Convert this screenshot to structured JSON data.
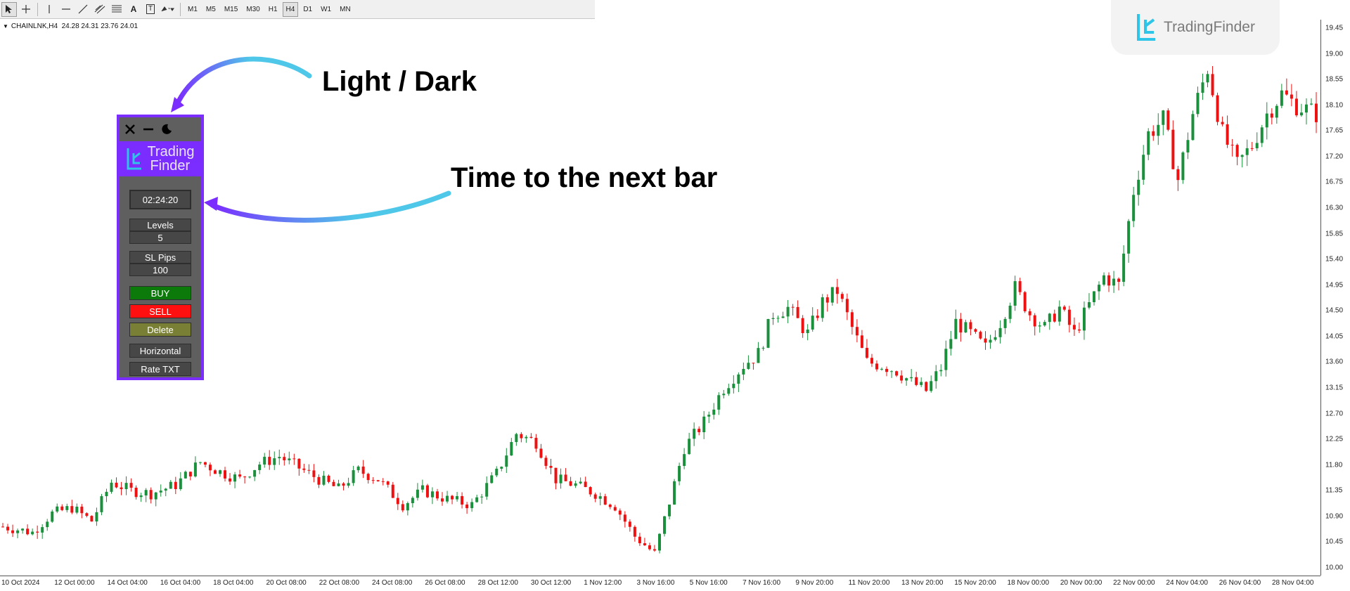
{
  "toolbar": {
    "tool_icons": [
      "cursor-icon",
      "crosshair-icon",
      "vertical-line-icon",
      "horizontal-line-icon",
      "trendline-icon",
      "channel-icon",
      "fibonacci-icon",
      "text-icon",
      "label-icon",
      "shapes-icon"
    ],
    "text_tool_label": "A",
    "label_tool_label": "T",
    "timeframes": [
      "M1",
      "M5",
      "M15",
      "M30",
      "H1",
      "H4",
      "D1",
      "W1",
      "MN"
    ],
    "active_timeframe": "H4"
  },
  "symbol_info": {
    "symbol": "CHAINLNK,H4",
    "ohlc": "24.28 24.31 23.76 24.01"
  },
  "brand": {
    "name": "TradingFinder",
    "color": "#2ec5e8"
  },
  "callouts": {
    "theme_toggle": "Light / Dark",
    "bar_timer": "Time to the next bar"
  },
  "panel": {
    "header_icons": [
      "close-icon",
      "minimize-icon",
      "moon-icon"
    ],
    "logo_line1": "Trading",
    "logo_line2": "Finder",
    "timer": "02:24:20",
    "levels_label": "Levels",
    "levels_value": "5",
    "sl_label": "SL Pips",
    "sl_value": "100",
    "buy_label": "BUY",
    "sell_label": "SELL",
    "delete_label": "Delete",
    "horizontal_label": "Horizontal",
    "rate_label": "Rate TXT",
    "accent_color": "#7b2cff"
  },
  "colors": {
    "bull": "#1a8f3c",
    "bear": "#ee1111"
  },
  "chart_data": {
    "type": "candlestick",
    "price_axis_labels": [
      "19.45",
      "19.00",
      "18.55",
      "18.10",
      "17.65",
      "17.20",
      "16.75",
      "16.30",
      "15.85",
      "15.40",
      "14.95",
      "14.50",
      "14.05",
      "13.60",
      "13.15",
      "12.70",
      "12.25",
      "11.80",
      "11.35",
      "10.90",
      "10.45",
      "10.00"
    ],
    "time_axis_labels": [
      "10 Oct 2024",
      "12 Oct 00:00",
      "14 Oct 04:00",
      "16 Oct 04:00",
      "18 Oct 04:00",
      "20 Oct 08:00",
      "22 Oct 08:00",
      "24 Oct 08:00",
      "26 Oct 08:00",
      "28 Oct 12:00",
      "30 Oct 12:00",
      "1 Nov 12:00",
      "3 Nov 16:00",
      "5 Nov 16:00",
      "7 Nov 16:00",
      "9 Nov 20:00",
      "11 Nov 20:00",
      "13 Nov 20:00",
      "15 Nov 20:00",
      "18 Nov 00:00",
      "20 Nov 00:00",
      "22 Nov 00:00",
      "24 Nov 04:00",
      "26 Nov 04:00",
      "28 Nov 04:00"
    ],
    "y_range": [
      9.9,
      19.5
    ],
    "close_path": [
      [
        0,
        10.72
      ],
      [
        6,
        10.62
      ],
      [
        10,
        10.95
      ],
      [
        14,
        11.05
      ],
      [
        18,
        10.82
      ],
      [
        22,
        11.5
      ],
      [
        26,
        11.35
      ],
      [
        30,
        11.3
      ],
      [
        35,
        11.45
      ],
      [
        40,
        11.85
      ],
      [
        44,
        11.68
      ],
      [
        48,
        11.55
      ],
      [
        52,
        11.82
      ],
      [
        56,
        11.95
      ],
      [
        60,
        11.75
      ],
      [
        64,
        11.55
      ],
      [
        68,
        11.38
      ],
      [
        72,
        11.7
      ],
      [
        76,
        11.55
      ],
      [
        81,
        11.1
      ],
      [
        85,
        11.35
      ],
      [
        90,
        11.2
      ],
      [
        95,
        11.1
      ],
      [
        100,
        11.65
      ],
      [
        104,
        12.35
      ],
      [
        108,
        12.2
      ],
      [
        112,
        11.55
      ],
      [
        116,
        11.45
      ],
      [
        120,
        11.3
      ],
      [
        124,
        11.08
      ],
      [
        128,
        10.55
      ],
      [
        132,
        10.25
      ],
      [
        135,
        11.15
      ],
      [
        138,
        12.1
      ],
      [
        142,
        12.55
      ],
      [
        146,
        13.15
      ],
      [
        150,
        13.55
      ],
      [
        153,
        13.75
      ],
      [
        156,
        14.45
      ],
      [
        159,
        14.55
      ],
      [
        163,
        14.1
      ],
      [
        166,
        14.65
      ],
      [
        169,
        14.85
      ],
      [
        172,
        14.2
      ],
      [
        175,
        13.6
      ],
      [
        178,
        13.55
      ],
      [
        181,
        13.45
      ],
      [
        184,
        13.25
      ],
      [
        187,
        13.1
      ],
      [
        190,
        13.5
      ],
      [
        193,
        14.3
      ],
      [
        196,
        14.1
      ],
      [
        199,
        13.85
      ],
      [
        202,
        14.3
      ],
      [
        205,
        14.9
      ],
      [
        208,
        14.45
      ],
      [
        211,
        14.2
      ],
      [
        214,
        14.55
      ],
      [
        217,
        14.1
      ],
      [
        220,
        14.6
      ],
      [
        223,
        15.1
      ],
      [
        226,
        14.95
      ],
      [
        229,
        16.6
      ],
      [
        232,
        17.6
      ],
      [
        235,
        17.85
      ],
      [
        238,
        16.8
      ],
      [
        241,
        17.95
      ],
      [
        244,
        18.75
      ],
      [
        247,
        17.6
      ],
      [
        250,
        17.05
      ],
      [
        253,
        17.4
      ],
      [
        256,
        17.95
      ],
      [
        259,
        18.3
      ],
      [
        262,
        18.1
      ],
      [
        266,
        17.95
      ]
    ],
    "n_candles": 267,
    "grid": false
  }
}
